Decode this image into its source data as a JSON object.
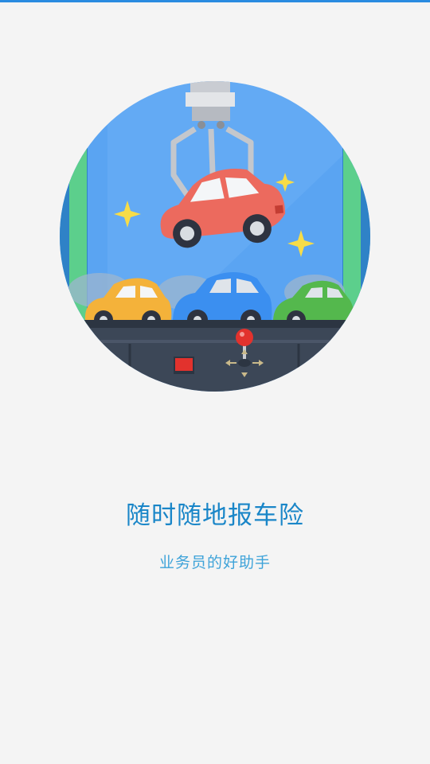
{
  "splash": {
    "title": "随时随地报车险",
    "subtitle": "业务员的好助手"
  },
  "illustration": {
    "subject": "claw-machine-picking-car",
    "colors": {
      "sky": "#5aa4f2",
      "frame_green": "#5ccf8c",
      "red_car": "#ec6a5e",
      "orange_car": "#f4b23a",
      "blue_car": "#3b8ff0",
      "green_car": "#54b84d",
      "base": "#3c4757",
      "sparkle": "#f7dc47"
    }
  },
  "theme": {
    "accent": "#1a86c8",
    "subtitle_color": "#3ea3d9",
    "background": "#f4f4f4",
    "top_bar": "#2a8be0"
  }
}
